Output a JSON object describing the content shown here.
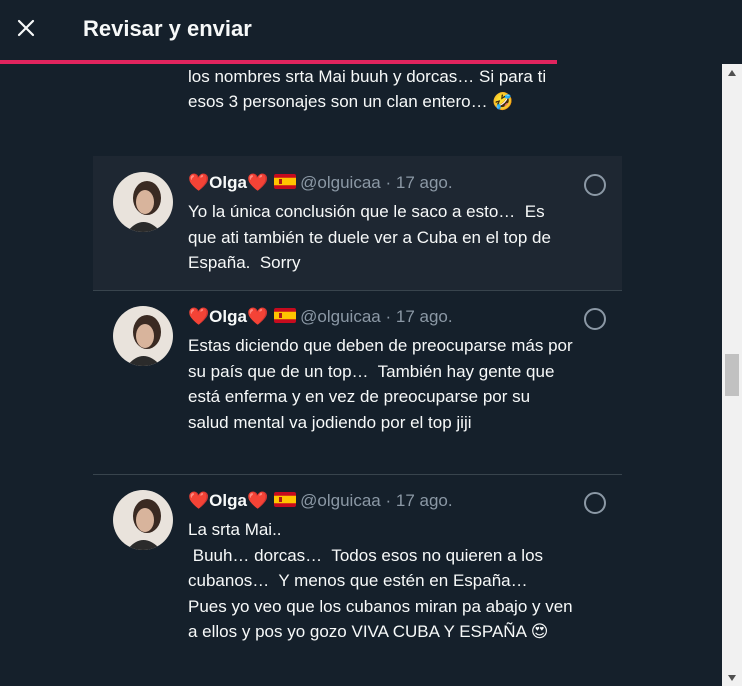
{
  "header": {
    "title": "Revisar y enviar",
    "close_icon": "close-icon",
    "progress_fraction": 0.75,
    "accent": "#e0245e"
  },
  "partial_tweet": {
    "text": "los nombres srta Mai buuh y dorcas…  Si para ti esos 3 personajes son un clan entero… 🤣"
  },
  "tweets": [
    {
      "heart_left": "❤️",
      "name": "Olga",
      "heart_right": "❤️",
      "flag_icon": "spain-flag-icon",
      "handle": "@olguicaa",
      "separator": "·",
      "date": "17 ago.",
      "text": "Yo la única conclusión que le saco a esto…  Es que ati también te duele ver a Cuba en el top de España.  Sorry",
      "highlighted": true
    },
    {
      "heart_left": "❤️",
      "name": "Olga",
      "heart_right": "❤️",
      "flag_icon": "spain-flag-icon",
      "handle": "@olguicaa",
      "separator": "·",
      "date": "17 ago.",
      "text": "Estas diciendo que deben de preocuparse más por su país que de un top…  También hay gente que está enferma y en vez de preocuparse por su salud mental va jodiendo por el top jiji",
      "highlighted": false
    },
    {
      "heart_left": "❤️",
      "name": "Olga",
      "heart_right": "❤️",
      "flag_icon": "spain-flag-icon",
      "handle": "@olguicaa",
      "separator": "·",
      "date": "17 ago.",
      "text": "La srta Mai..\n Buuh… dorcas…  Todos esos no quieren a los cubanos…  Y menos que estén en España…  Pues yo veo que los cubanos miran pa abajo y ven a ellos y pos yo gozo VIVA CUBA Y ESPAÑA 😍",
      "highlighted": false
    }
  ],
  "scrollbar": {
    "position_fraction": 0.5
  }
}
